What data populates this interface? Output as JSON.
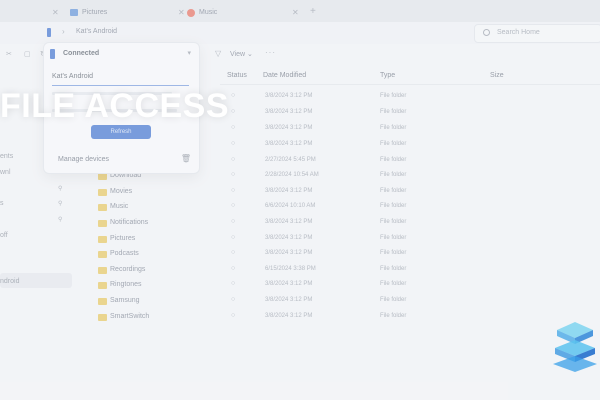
{
  "headline": "FILE ACCESS",
  "tabs": [
    {
      "label": "Pictures",
      "icon": "pictures-folder-icon"
    },
    {
      "label": "Music",
      "icon": "music-icon"
    }
  ],
  "address": {
    "path": "Kat's Android"
  },
  "search": {
    "placeholder": "Search Home"
  },
  "toolbar": {
    "view_label": "View"
  },
  "columns": {
    "status": "Status",
    "date_modified": "Date Modified",
    "type": "Type",
    "size": "Size"
  },
  "sidebar": {
    "items": [
      "ents",
      "wnl",
      "s",
      "off",
      "ndroid"
    ]
  },
  "popup": {
    "status": "Connected",
    "device_name": "Kat's Android",
    "button_label": "Refresh",
    "manage_label": "Manage devices"
  },
  "files": [
    {
      "name": "",
      "date": "3/8/2024 3:12 PM",
      "type": "File folder"
    },
    {
      "name": "",
      "date": "3/8/2024 3:12 PM",
      "type": "File folder"
    },
    {
      "name": "",
      "date": "3/8/2024 3:12 PM",
      "type": "File folder"
    },
    {
      "name": "",
      "date": "3/8/2024 3:12 PM",
      "type": "File folder"
    },
    {
      "name": "",
      "date": "2/27/2024 5:45 PM",
      "type": "File folder"
    },
    {
      "name": "Download",
      "date": "2/28/2024 10:54 AM",
      "type": "File folder"
    },
    {
      "name": "Movies",
      "date": "3/8/2024 3:12 PM",
      "type": "File folder"
    },
    {
      "name": "Music",
      "date": "6/6/2024 10:10 AM",
      "type": "File folder"
    },
    {
      "name": "Notifications",
      "date": "3/8/2024 3:12 PM",
      "type": "File folder"
    },
    {
      "name": "Pictures",
      "date": "3/8/2024 3:12 PM",
      "type": "File folder"
    },
    {
      "name": "Podcasts",
      "date": "3/8/2024 3:12 PM",
      "type": "File folder"
    },
    {
      "name": "Recordings",
      "date": "6/15/2024 3:38 PM",
      "type": "File folder"
    },
    {
      "name": "Ringtones",
      "date": "3/8/2024 3:12 PM",
      "type": "File folder"
    },
    {
      "name": "Samsung",
      "date": "3/8/2024 3:12 PM",
      "type": "File folder"
    },
    {
      "name": "SmartSwitch",
      "date": "3/8/2024 3:12 PM",
      "type": "File folder"
    }
  ],
  "colors": {
    "accent": "#3b6fd0",
    "folder": "#e8c65a",
    "headline": "#ffffff"
  }
}
